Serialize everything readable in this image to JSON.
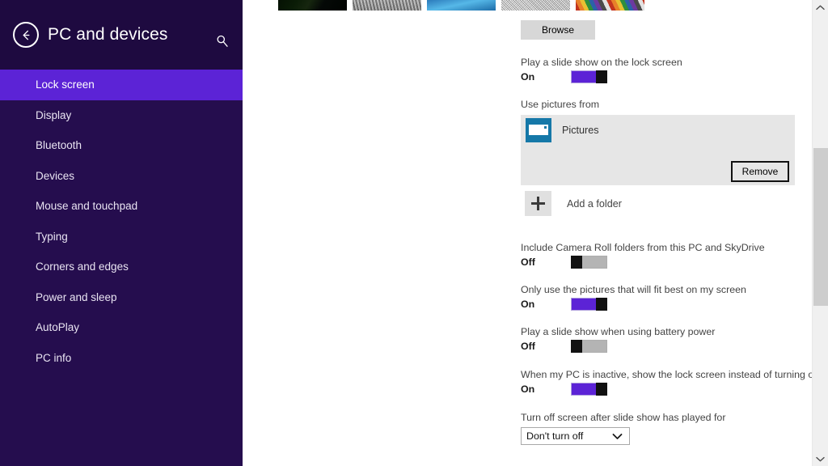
{
  "sidebar": {
    "back_label": "back-arrow",
    "title": "PC and devices",
    "search_icon": "search-icon",
    "items": [
      {
        "label": "Lock screen",
        "selected": true
      },
      {
        "label": "Display",
        "selected": false
      },
      {
        "label": "Bluetooth",
        "selected": false
      },
      {
        "label": "Devices",
        "selected": false
      },
      {
        "label": "Mouse and touchpad",
        "selected": false
      },
      {
        "label": "Typing",
        "selected": false
      },
      {
        "label": "Corners and edges",
        "selected": false
      },
      {
        "label": "Power and sleep",
        "selected": false
      },
      {
        "label": "AutoPlay",
        "selected": false
      },
      {
        "label": "PC info",
        "selected": false
      }
    ]
  },
  "content": {
    "thumbnails": [
      {
        "name": "thumbnail-dark-leaf"
      },
      {
        "name": "thumbnail-gray-rock"
      },
      {
        "name": "thumbnail-green-blue-curve"
      },
      {
        "name": "thumbnail-gray-speckle"
      },
      {
        "name": "thumbnail-color-pencils"
      }
    ],
    "browse_button": "Browse",
    "slideshow": {
      "label": "Play a slide show on the lock screen",
      "state": "On",
      "on": true
    },
    "use_pictures_from": {
      "label": "Use pictures from",
      "folders": [
        {
          "name": "Pictures",
          "icon": "pictures-folder-icon"
        }
      ],
      "remove_button": "Remove",
      "add_folder_label": "Add a folder",
      "add_folder_icon": "plus-icon"
    },
    "camera_roll": {
      "label": "Include Camera Roll folders from this PC and SkyDrive",
      "state": "Off",
      "on": false
    },
    "fit_best": {
      "label": "Only use the pictures that will fit best on my screen",
      "state": "On",
      "on": true
    },
    "battery_power": {
      "label": "Play a slide show when using battery power",
      "state": "Off",
      "on": false
    },
    "inactive_lock": {
      "label": "When my PC is inactive, show the lock screen instead of turning off the screen",
      "state": "On",
      "on": true
    },
    "turn_off_screen": {
      "label": "Turn off screen after slide show has played for",
      "selected_value": "Don't turn off",
      "chevron_icon": "chevron-down-icon"
    }
  },
  "scrollbar": {
    "up_icon": "chevron-up-icon",
    "down_icon": "chevron-down-icon"
  },
  "colors": {
    "sidebar_bg": "#250d4e",
    "sidebar_header_bg": "#1e0a40",
    "accent": "#5c23d6",
    "toggle_off_track": "#b4b4b4",
    "panel_bg": "#e6e6e6"
  }
}
